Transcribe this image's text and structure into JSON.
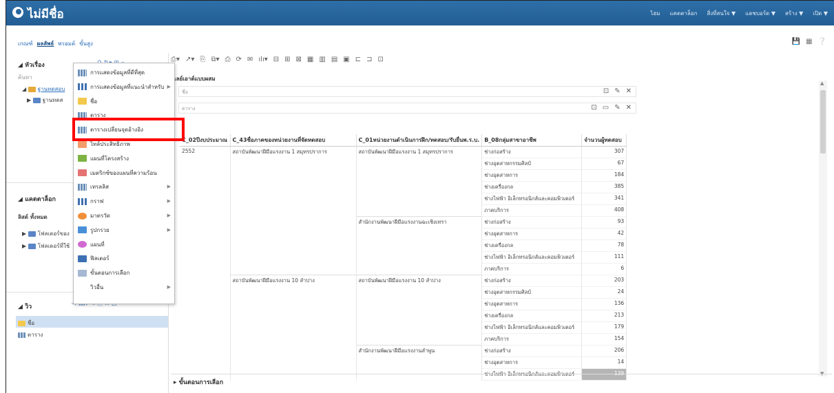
{
  "app": {
    "title": "ไม่มีชื่อ",
    "menu": [
      "ไฮม",
      "แคตตาล็อก",
      "สิ่งที่สนใจ ▼",
      "แดชบอร์ด ▼",
      "สร้าง ▼",
      "เปิด ▼"
    ]
  },
  "subheader": {
    "tabs": [
      "เกณฑ์",
      "ผลลัพธ์",
      "พรอมต์",
      "ขั้นสูง"
    ],
    "active_tab": "ผลลัพธ์"
  },
  "left_pane": {
    "topics_header": "หัวเรื่อง",
    "search_label": "ค้นหา",
    "subject_area": "ฐานทดสอบ",
    "subject_area_child": "ฐานทดส",
    "catalog_header": "แคตตาล็อก",
    "catalog_filter": "ลิสต์ ทั้งหมด",
    "catalog_items": [
      "โฟลเดอร์ของ",
      "โฟลเดอร์ที่ใช้"
    ],
    "views_header": "วิว",
    "views": [
      "ชื่อ",
      "ตาราง"
    ]
  },
  "dropdown": {
    "items": [
      {
        "label": "การแสดงข้อมูลที่ดีที่สุด",
        "icon": "grid-icon",
        "submenu": false
      },
      {
        "label": "การแสดงข้อมูลที่แนะนำสำหรับ",
        "icon": "bar-chart-icon",
        "submenu": true
      },
      {
        "label": "ชื่อ",
        "icon": "title-icon",
        "submenu": false
      },
      {
        "label": "ตาราง",
        "icon": "table-icon",
        "submenu": false
      },
      {
        "label": "ตารางเปลี่ยนจุดอ้างอิง",
        "icon": "pivot-table-icon",
        "submenu": false
      },
      {
        "label": "ไทล์ประสิทธิภาพ",
        "icon": "performance-tile-icon",
        "submenu": false
      },
      {
        "label": "แผนที่โครงสร้าง",
        "icon": "treemap-icon",
        "submenu": false
      },
      {
        "label": "เมตริกซ์ของแผนที่ความร้อน",
        "icon": "heatmap-icon",
        "submenu": false
      },
      {
        "label": "เทรลลิส",
        "icon": "trellis-icon",
        "submenu": true
      },
      {
        "label": "กราฟ",
        "icon": "graph-icon",
        "submenu": true
      },
      {
        "label": "มาตรวัด",
        "icon": "gauge-icon",
        "submenu": true
      },
      {
        "label": "รูปกรวย",
        "icon": "funnel-icon",
        "submenu": true
      },
      {
        "label": "แผนที่",
        "icon": "map-icon",
        "submenu": false
      },
      {
        "label": "ฟิลเตอร์",
        "icon": "filter-icon",
        "submenu": false
      },
      {
        "label": "ขั้นตอนการเลือก",
        "icon": "selection-steps-icon",
        "submenu": false
      },
      {
        "label": "วิวอื่น",
        "icon": "",
        "submenu": true
      }
    ]
  },
  "main": {
    "layout_title": "เลย์เอาต์แบบผสม",
    "title_box_label": "ชื่อ",
    "table_box_label": "ตาราง",
    "columns": [
      "C_02ปีงบประมาณ",
      "C_43ชื่อภาคของหน่วยงานที่จัดทดสอบ",
      "C_01หน่วยงานดำเนินการฝึก/ทดสอบ/รับยื่นพ.ร.บ.",
      "B_08กลุ่มสาขาอาชีพ",
      "จำนวนผู้ทดสอบ"
    ],
    "year": "2552",
    "groups": [
      {
        "region": "สถาบันพัฒนาฝีมือแรงงาน 1 สมุทรปราการ",
        "units": [
          {
            "unit": "สถาบันพัฒนาฝีมือแรงงาน 1 สมุทรปราการ",
            "rows": [
              {
                "occupation": "ช่างก่อสร้าง",
                "count": "307"
              },
              {
                "occupation": "ช่างอุตสาหกรรมศิลป์",
                "count": "67"
              },
              {
                "occupation": "ช่างอุตสาหการ",
                "count": "184"
              },
              {
                "occupation": "ช่างเครื่องกล",
                "count": "385"
              },
              {
                "occupation": "ช่างไฟฟ้า อิเล็กทรอนิกส์และคอมพิวเตอร์",
                "count": "341"
              },
              {
                "occupation": "ภาคบริการ",
                "count": "408"
              }
            ]
          },
          {
            "unit": "สำนักงานพัฒนาฝีมือแรงงานฉะเชิงเทรา",
            "rows": [
              {
                "occupation": "ช่างก่อสร้าง",
                "count": "93"
              },
              {
                "occupation": "ช่างอุตสาหการ",
                "count": "42"
              },
              {
                "occupation": "ช่างเครื่องกล",
                "count": "78"
              },
              {
                "occupation": "ช่างไฟฟ้า อิเล็กทรอนิกส์และคอมพิวเตอร์",
                "count": "111"
              },
              {
                "occupation": "ภาคบริการ",
                "count": "6"
              }
            ]
          }
        ]
      },
      {
        "region": "สถาบันพัฒนาฝีมือแรงงาน 10 ลำปาง",
        "units": [
          {
            "unit": "สถาบันพัฒนาฝีมือแรงงาน 10 ลำปาง",
            "rows": [
              {
                "occupation": "ช่างก่อสร้าง",
                "count": "203"
              },
              {
                "occupation": "ช่างอุตสาหกรรมศิลป์",
                "count": "24"
              },
              {
                "occupation": "ช่างอุตสาหการ",
                "count": "136"
              },
              {
                "occupation": "ช่างเครื่องกล",
                "count": "213"
              },
              {
                "occupation": "ช่างไฟฟ้า อิเล็กทรอนิกส์และคอมพิวเตอร์",
                "count": "179"
              },
              {
                "occupation": "ภาคบริการ",
                "count": "154"
              }
            ]
          },
          {
            "unit": "สำนักงานพัฒนาฝีมือแรงงานลำพูน",
            "rows": [
              {
                "occupation": "ช่างก่อสร้าง",
                "count": "206"
              },
              {
                "occupation": "ช่างอุตสาหการ",
                "count": "14"
              },
              {
                "occupation": "ช่างไฟฟ้า อิเล็กทรอนิกส์และคอมพิวเตอร์",
                "count": "139"
              }
            ]
          }
        ]
      }
    ],
    "selection_steps": "ขั้นตอนการเลือก"
  }
}
